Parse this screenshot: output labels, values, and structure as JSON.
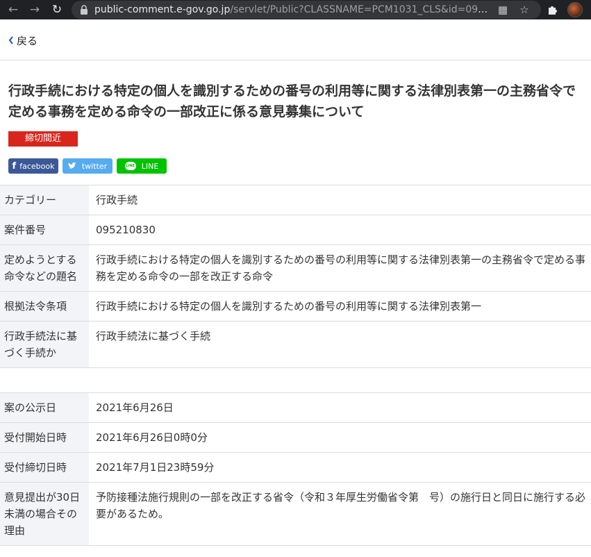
{
  "browser": {
    "url_host": "public-comment.e-gov.go.jp",
    "url_path": "/servlet/Public?CLASSNAME=PCM1031_CLS&id=0952..."
  },
  "page": {
    "back_label": "戻る",
    "title": "行政手続における特定の個人を識別するための番号の利用等に関する法律別表第一の主務省令で定める事務を定める命令の一部改正に係る意見募集について",
    "badge": "締切間近",
    "share": {
      "facebook": "facebook",
      "twitter": "twitter",
      "line": "LINE",
      "line_icon_text": "LINE"
    }
  },
  "table1": {
    "rows": [
      {
        "label": "カテゴリー",
        "value": "行政手続"
      },
      {
        "label": "案件番号",
        "value": "095210830"
      },
      {
        "label": "定めようとする命令などの題名",
        "value": "行政手続における特定の個人を識別するための番号の利用等に関する法律別表第一の主務省令で定める事務を定める命令の一部を改正する命令"
      },
      {
        "label": "根拠法令条項",
        "value": "行政手続における特定の個人を識別するための番号の利用等に関する法律別表第一"
      },
      {
        "label": "行政手続法に基づく手続か",
        "value": "行政手続法に基づく手続"
      }
    ]
  },
  "table2": {
    "rows": [
      {
        "label": "案の公示日",
        "value": "2021年6月26日"
      },
      {
        "label": "受付開始日時",
        "value": "2021年6月26日0時0分"
      },
      {
        "label": "受付締切日時",
        "value": "2021年7月1日23時59分"
      },
      {
        "label": "意見提出が30日未満の場合その理由",
        "value": "予防接種法施行規則の一部を改正する省令（令和３年厚生労働省令第　号）の施行日と同日に施行する必要があるため。"
      }
    ]
  },
  "colors": {
    "badge": "#d8261c",
    "facebook": "#3b5998",
    "twitter": "#55acee",
    "line": "#00c300",
    "label_bg": "#f2f4f7"
  }
}
